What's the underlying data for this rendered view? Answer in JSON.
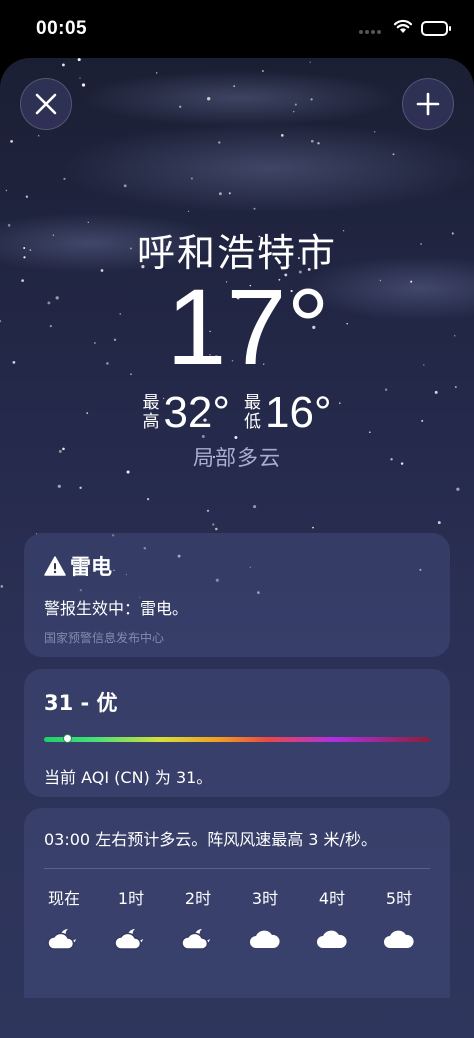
{
  "status": {
    "time": "00:05",
    "icons": [
      "cellular-dots-icon",
      "wifi-icon",
      "battery-icon"
    ]
  },
  "header": {
    "close_icon": "close-icon",
    "add_icon": "plus-icon"
  },
  "weather": {
    "city": "呼和浩特市",
    "temperature": "17°",
    "high_label_top": "最",
    "high_label_bottom": "高",
    "high": "32°",
    "low_label_top": "最",
    "low_label_bottom": "低",
    "low": "16°",
    "condition": "局部多云"
  },
  "alert": {
    "title": "雷电",
    "icon": "warning-triangle-icon",
    "body": "警报生效中：雷电。",
    "source": "国家预警信息发布中心"
  },
  "aqi": {
    "title": "31 - 优",
    "level_fraction": 0.06,
    "text": "当前 AQI (CN) 为 31。"
  },
  "forecast": {
    "summary": "03:00 左右预计多云。阵风风速最高 3 米/秒。",
    "hours": [
      {
        "label": "现在",
        "icon": "cloud-moon-icon"
      },
      {
        "label": "1时",
        "icon": "cloud-moon-icon"
      },
      {
        "label": "2时",
        "icon": "cloud-moon-icon"
      },
      {
        "label": "3时",
        "icon": "cloud-icon"
      },
      {
        "label": "4时",
        "icon": "cloud-icon"
      },
      {
        "label": "5时",
        "icon": "cloud-icon"
      }
    ]
  },
  "colors": {
    "background_top": "#1b1f34",
    "background_bottom": "#2f365d",
    "card": "#3a4270"
  }
}
